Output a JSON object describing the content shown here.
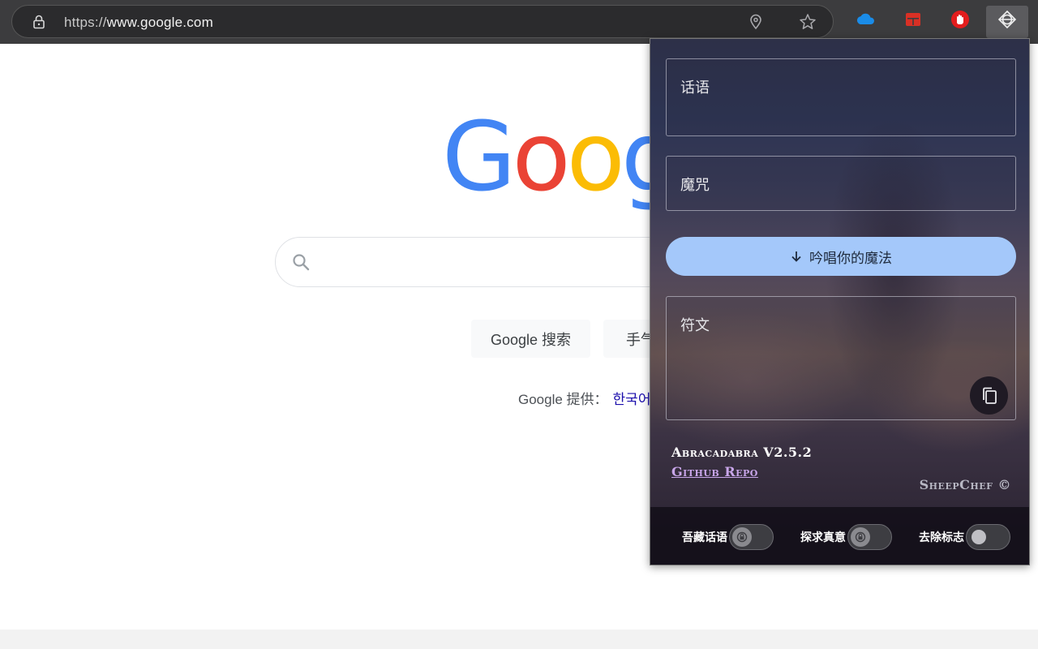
{
  "browser": {
    "url_prefix": "https://",
    "url_domain": "www.google.com",
    "icons": [
      "lock-icon",
      "location-pin-icon",
      "star-icon",
      "onedrive-icon",
      "red-extension-icon",
      "hand-extension-icon",
      "abracadabra-extension-icon"
    ]
  },
  "google": {
    "logo_letters": [
      "G",
      "o",
      "o",
      "g"
    ],
    "logo_colors": [
      "#4285F4",
      "#EA4335",
      "#FBBC05",
      "#4285F4"
    ],
    "search_button": "Google 搜索",
    "lucky_button": "手气",
    "offered_in": "Google 提供：",
    "offered_lang": "한국어"
  },
  "popup": {
    "field1_label": "话语",
    "field2_label": "魔咒",
    "cast_button": "吟唱你的魔法",
    "output_label": "符文",
    "version": "Abracadabra V2.5.2",
    "repo_link": "Github Repo",
    "credit": "SheepChef ©",
    "toggles": [
      {
        "label": "吾藏话语",
        "on": false
      },
      {
        "label": "探求真意",
        "on": false
      },
      {
        "label": "去除标志",
        "on": false
      }
    ],
    "accent_color": "#a4c8fa"
  }
}
